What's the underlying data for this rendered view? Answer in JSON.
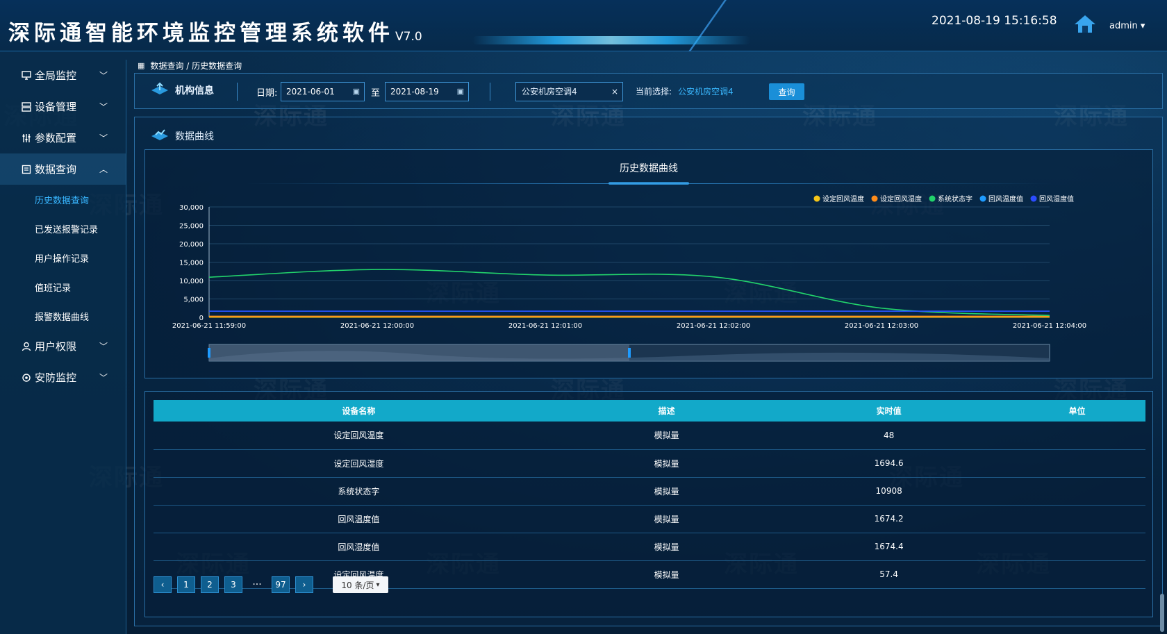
{
  "header": {
    "title": "深际通智能环境监控管理系统软件",
    "version": "V7.0",
    "datetime": "2021-08-19 15:16:58",
    "user": "admin"
  },
  "watermark_text": "深际通",
  "sidebar": {
    "items": [
      {
        "label": "全局监控",
        "icon": "monitor-icon",
        "expanded": false
      },
      {
        "label": "设备管理",
        "icon": "server-icon",
        "expanded": false
      },
      {
        "label": "参数配置",
        "icon": "sliders-icon",
        "expanded": false
      },
      {
        "label": "数据查询",
        "icon": "document-icon",
        "expanded": true
      },
      {
        "label": "用户权限",
        "icon": "user-icon",
        "expanded": false
      },
      {
        "label": "安防监控",
        "icon": "camera-icon",
        "expanded": false
      }
    ],
    "sub_items": [
      "历史数据查询",
      "已发送报警记录",
      "用户操作记录",
      "值班记录",
      "报警数据曲线"
    ]
  },
  "breadcrumb": "数据查询 / 历史数据查询",
  "filter": {
    "org_label": "机构信息",
    "date_label": "日期:",
    "date_from": "2021-06-01",
    "to_label": "至",
    "date_to": "2021-08-19",
    "device_select": "公安机房空调4",
    "current_label": "当前选择:",
    "current_value": "公安机房空调4",
    "query_button": "查询"
  },
  "panel": {
    "title": "数据曲线"
  },
  "chart_data": {
    "type": "line",
    "title": "历史数据曲线",
    "x": [
      "2021-06-21 11:59:00",
      "2021-06-21 12:00:00",
      "2021-06-21 12:01:00",
      "2021-06-21 12:02:00",
      "2021-06-21 12:03:00",
      "2021-06-21 12:04:00"
    ],
    "ylim": [
      0,
      30000
    ],
    "yticks": [
      0,
      5000,
      10000,
      15000,
      20000,
      25000,
      30000
    ],
    "ytick_labels": [
      "0",
      "5,000",
      "10,000",
      "15,000",
      "20,000",
      "25,000",
      "30,000"
    ],
    "legend_position": "top-right",
    "series": [
      {
        "name": "设定回风温度",
        "color": "#f5c518",
        "values": [
          48,
          48,
          48,
          48,
          48,
          48
        ]
      },
      {
        "name": "设定回风湿度",
        "color": "#ff8c1a",
        "values": [
          300,
          300,
          300,
          300,
          300,
          300
        ]
      },
      {
        "name": "系统状态字",
        "color": "#22d36b",
        "values": [
          10908,
          13000,
          11500,
          11000,
          2500,
          500
        ]
      },
      {
        "name": "回风温度值",
        "color": "#1e9bff",
        "values": [
          1674,
          1674,
          1674,
          1674,
          1674,
          1674
        ]
      },
      {
        "name": "回风湿度值",
        "color": "#2b4cff",
        "values": [
          1674,
          1674,
          1674,
          1674,
          1674,
          1674
        ]
      }
    ],
    "zoom_range": [
      0,
      50
    ]
  },
  "table": {
    "headers": [
      "设备名称",
      "描述",
      "实时值",
      "单位"
    ],
    "rows": [
      [
        "设定回风温度",
        "模拟量",
        "48",
        ""
      ],
      [
        "设定回风湿度",
        "模拟量",
        "1694.6",
        ""
      ],
      [
        "系统状态字",
        "模拟量",
        "10908",
        ""
      ],
      [
        "回风温度值",
        "模拟量",
        "1674.2",
        ""
      ],
      [
        "回风湿度值",
        "模拟量",
        "1674.4",
        ""
      ],
      [
        "设定回风温度",
        "模拟量",
        "57.4",
        ""
      ]
    ]
  },
  "pagination": {
    "prev": "‹",
    "pages": [
      "1",
      "2",
      "3"
    ],
    "dots": "···",
    "last": "97",
    "next": "›",
    "page_size": "10 条/页"
  }
}
